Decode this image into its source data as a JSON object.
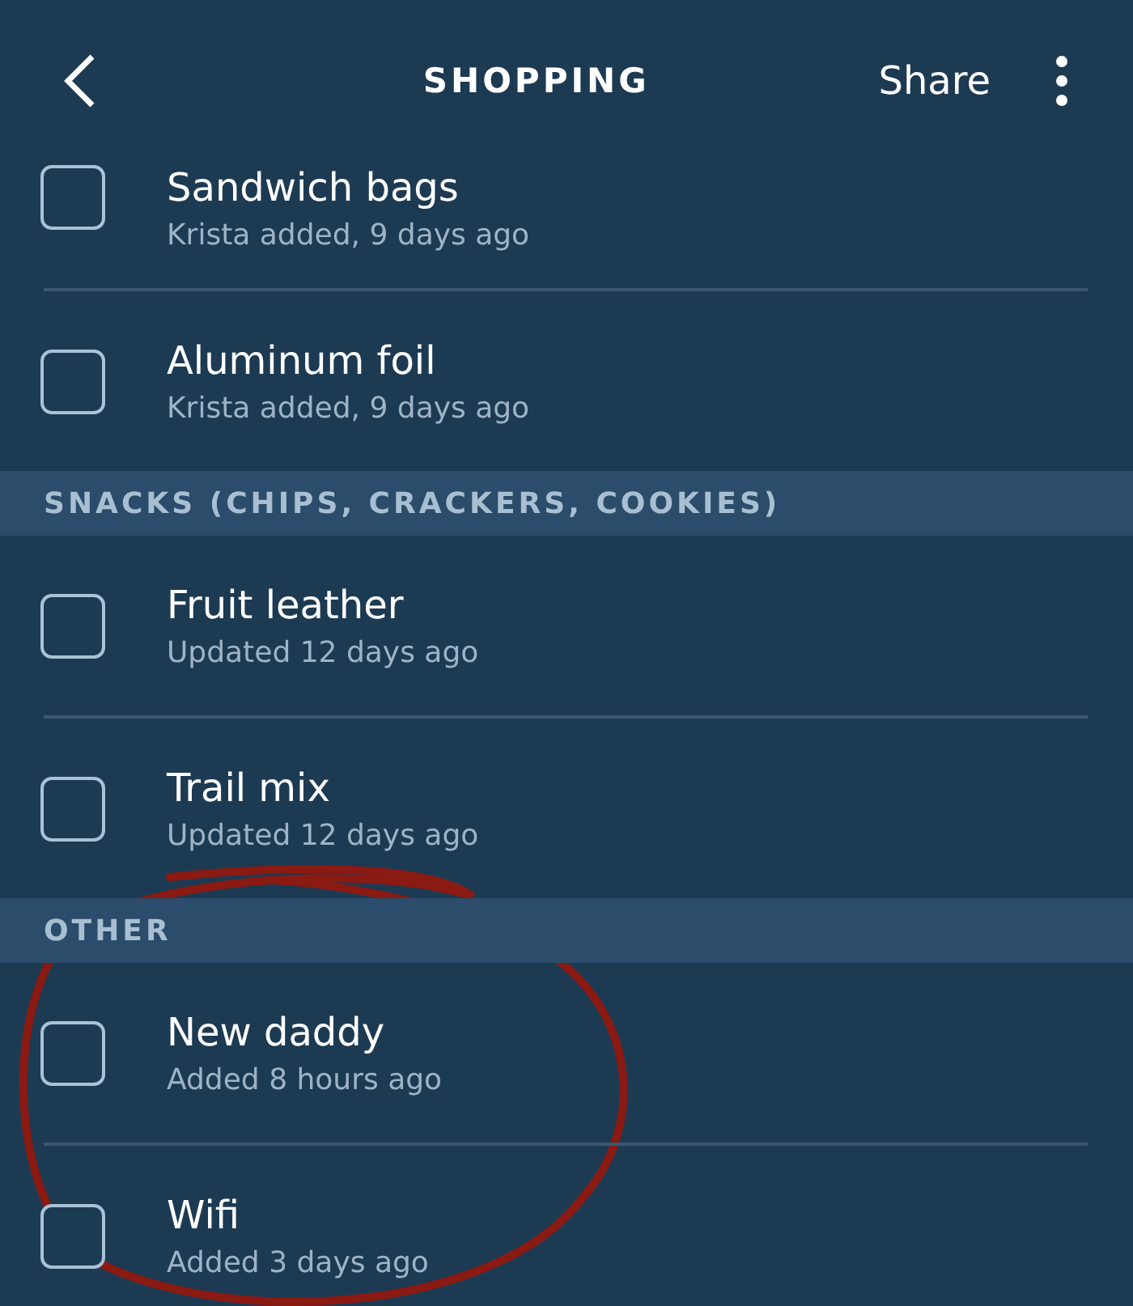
{
  "header": {
    "title": "SHOPPING",
    "share": "Share"
  },
  "sections": [
    {
      "items": [
        {
          "name": "Sandwich bags",
          "meta": "Krista added, 9 days ago",
          "checked": false
        },
        {
          "name": "Aluminum foil",
          "meta": "Krista added, 9 days ago",
          "checked": false
        }
      ]
    },
    {
      "heading": "SNACKS (CHIPS, CRACKERS, COOKIES)",
      "items": [
        {
          "name": "Fruit leather",
          "meta": "Updated 12 days ago",
          "checked": false
        },
        {
          "name": "Trail mix",
          "meta": "Updated 12 days ago",
          "checked": false
        }
      ]
    },
    {
      "heading": "OTHER",
      "items": [
        {
          "name": "New daddy",
          "meta": "Added 8 hours ago",
          "checked": false
        },
        {
          "name": "Wifi",
          "meta": "Added 3 days ago",
          "checked": false
        }
      ]
    }
  ]
}
